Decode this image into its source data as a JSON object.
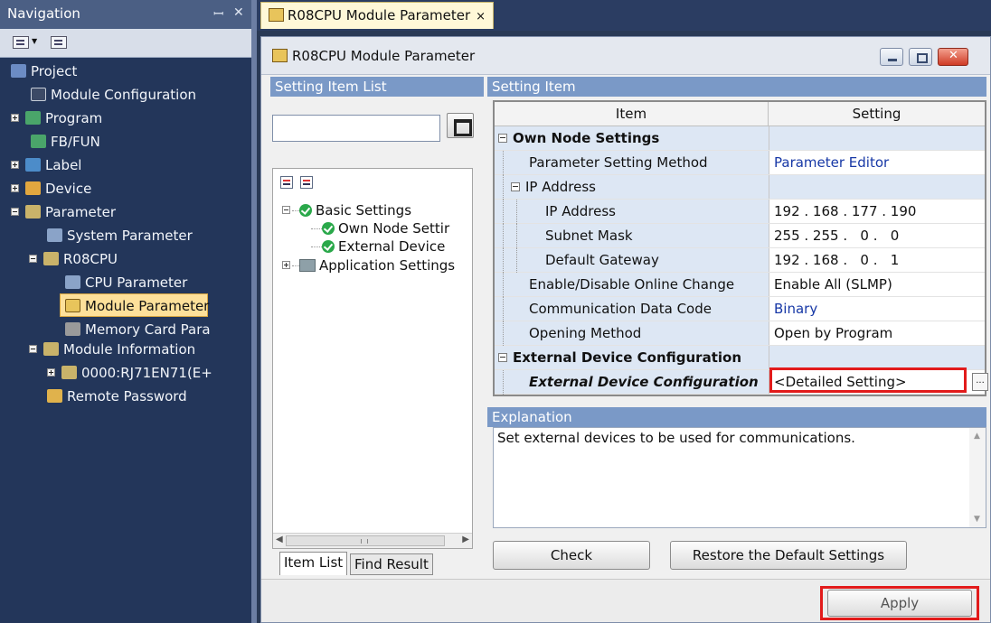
{
  "navigation": {
    "title": "Navigation",
    "pin": "ꟷ",
    "close": "✕",
    "tree": [
      {
        "label": "Project"
      },
      {
        "label": "Module Configuration"
      },
      {
        "label": "Program"
      },
      {
        "label": "FB/FUN"
      },
      {
        "label": "Label"
      },
      {
        "label": "Device"
      },
      {
        "label": "Parameter"
      },
      {
        "label": "System Parameter"
      },
      {
        "label": "R08CPU"
      },
      {
        "label": "CPU Parameter"
      },
      {
        "label": "Module Parameter"
      },
      {
        "label": "Memory Card Para"
      },
      {
        "label": "Module Information"
      },
      {
        "label": "0000:RJ71EN71(E+"
      },
      {
        "label": "Remote Password"
      }
    ]
  },
  "tab": {
    "label": "R08CPU Module Parameter",
    "close": "×"
  },
  "window": {
    "title": "R08CPU Module Parameter"
  },
  "setting_item_list": {
    "header": "Setting Item List",
    "search_value": "",
    "tree": [
      {
        "label": "Basic Settings"
      },
      {
        "label": "Own Node Settir"
      },
      {
        "label": "External Device"
      },
      {
        "label": "Application Settings"
      }
    ],
    "scroll_thumb": "III",
    "tabs": [
      "Item List",
      "Find Result"
    ]
  },
  "setting_item": {
    "header": "Setting Item",
    "columns": [
      "Item",
      "Setting"
    ],
    "rows": [
      {
        "item": "Own Node Settings",
        "setting": ""
      },
      {
        "item": "Parameter Setting Method",
        "setting": "Parameter Editor"
      },
      {
        "item": "IP Address",
        "setting": ""
      },
      {
        "item": "IP Address",
        "setting": "192 . 168 . 177 . 190"
      },
      {
        "item": "Subnet Mask",
        "setting": "255 . 255 .   0 .   0"
      },
      {
        "item": "Default Gateway",
        "setting": "192 . 168 .   0 .   1"
      },
      {
        "item": "Enable/Disable Online Change",
        "setting": "Enable All (SLMP)"
      },
      {
        "item": "Communication Data Code",
        "setting": "Binary"
      },
      {
        "item": "Opening Method",
        "setting": "Open by Program"
      },
      {
        "item": "External Device Configuration",
        "setting": ""
      },
      {
        "item": "External Device Configuration",
        "setting": "<Detailed Setting>"
      }
    ],
    "detail_button": "..."
  },
  "explanation": {
    "header": "Explanation",
    "text": "Set external devices to be used for communications."
  },
  "buttons": {
    "check": "Check",
    "restore": "Restore the Default Settings",
    "apply": "Apply"
  },
  "colors": {
    "highlight_box": "#e21b1b",
    "section_header": "#7a99c7",
    "link_blue": "#1738a6",
    "selected_nav": "#fde09a"
  }
}
